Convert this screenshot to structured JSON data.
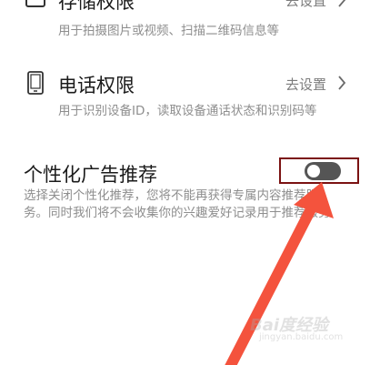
{
  "storage_row": {
    "title": "存储权限",
    "action": "去设置",
    "description": "用于拍摄图片或视频、扫描二维码信息等",
    "icon": "storage-folder-icon"
  },
  "phone_row": {
    "title": "电话权限",
    "action": "去设置",
    "description": "用于识别设备ID，读取设备通话状态和识别码等",
    "icon": "phone-device-icon"
  },
  "ad_row": {
    "title": "个性化广告推荐",
    "description": "选择关闭个性化推荐，您将不能再获得专属内容推荐服务。同时我们将不会收集你的兴趣爱好记录用于推荐服务",
    "toggle_on": false
  },
  "annotation": {
    "highlight_color": "#7b1212",
    "arrow_color": "#f4533d"
  },
  "watermark": {
    "main": "Bai度经验",
    "sub": "jingyan.baidu.com"
  }
}
